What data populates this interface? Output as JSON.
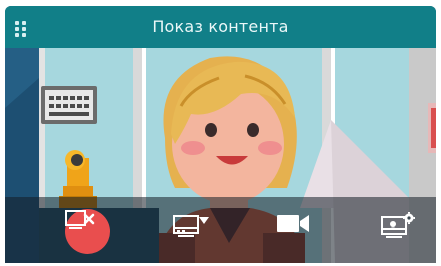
{
  "window": {
    "title": "Показ контента"
  },
  "controls": {
    "stop_sharing": {
      "icon": "screen-off-icon",
      "color": "#e94e4e"
    },
    "share_screen": {
      "icon": "screen-share-dropdown-icon"
    },
    "camera": {
      "icon": "camera-icon"
    },
    "presentation_settings": {
      "icon": "screen-settings-icon"
    }
  },
  "colors": {
    "titlebar": "#117f88",
    "accent_red": "#e94e4e",
    "video_bg": "#a5d6dd"
  }
}
